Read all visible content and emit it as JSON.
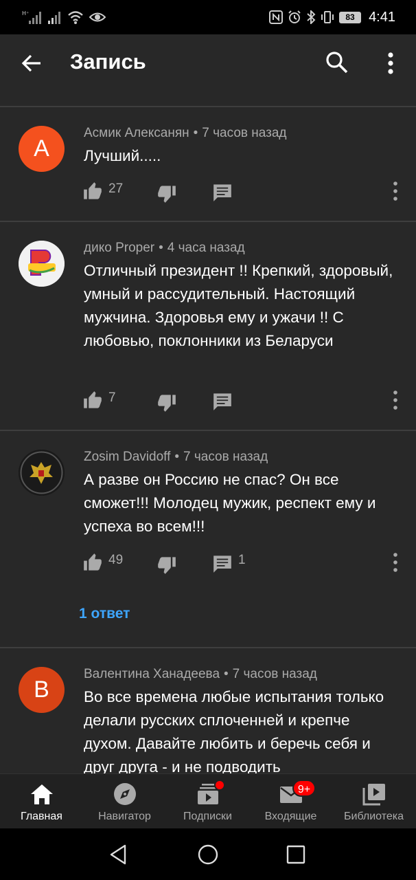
{
  "status_bar": {
    "left_icons": [
      "signal-h-icon",
      "signal-icon",
      "wifi-icon",
      "eye-icon"
    ],
    "right_icons": [
      "nfc-icon",
      "alarm-icon",
      "bluetooth-icon",
      "vibrate-icon"
    ],
    "battery": "83",
    "time": "4:41"
  },
  "appbar": {
    "title": "Запись",
    "icons": [
      "back-arrow-icon",
      "search-icon",
      "more-vert-icon"
    ]
  },
  "comments": [
    {
      "author": "Асмик Алексанян",
      "time": "7 часов назад",
      "avatar_letter": "А",
      "avatar_color": "#f4511e",
      "text": "Лучший.....",
      "likes": "27",
      "replies_count": ""
    },
    {
      "author": "дико Proper",
      "time": "4 часа назад",
      "avatar_letter": "",
      "avatar_color": "#f5f5f5",
      "text": "Отличный президент !! Крепкий, здоровый, умный и рассудительный. Настоящий мужчина. Здоровья ему и ужачи !! С любовью, поклонники из Беларуси",
      "likes": "7",
      "replies_count": ""
    },
    {
      "author": "Zosim Davidoff",
      "time": "7 часов назад",
      "avatar_letter": "",
      "avatar_color": "#111111",
      "text": "А разве он Россию не спас? Он все сможет!!! Молодец мужик, респект ему и успеха во всем!!!",
      "likes": "49",
      "replies_count": "1",
      "replies_link": "1 ответ"
    },
    {
      "author": "Валентина Ханадеева",
      "time": "7 часов назад",
      "avatar_letter": "В",
      "avatar_color": "#d84315",
      "text": "Во все времена любые испытания только делали русских сплоченней и крепче духом. Давайте любить и беречь себя и друг друга - и не подводить",
      "likes": "",
      "replies_count": ""
    }
  ],
  "bottom_nav": [
    {
      "label": "Главная",
      "icon": "home-icon",
      "active": true
    },
    {
      "label": "Навигатор",
      "icon": "explore-icon"
    },
    {
      "label": "Подписки",
      "icon": "subscriptions-icon",
      "badge": "dot"
    },
    {
      "label": "Входящие",
      "icon": "inbox-icon",
      "badge": "9+"
    },
    {
      "label": "Библиотека",
      "icon": "library-icon"
    }
  ],
  "colors": {
    "background": "#282828",
    "link": "#3ea6ff",
    "badge": "#ff0000"
  }
}
